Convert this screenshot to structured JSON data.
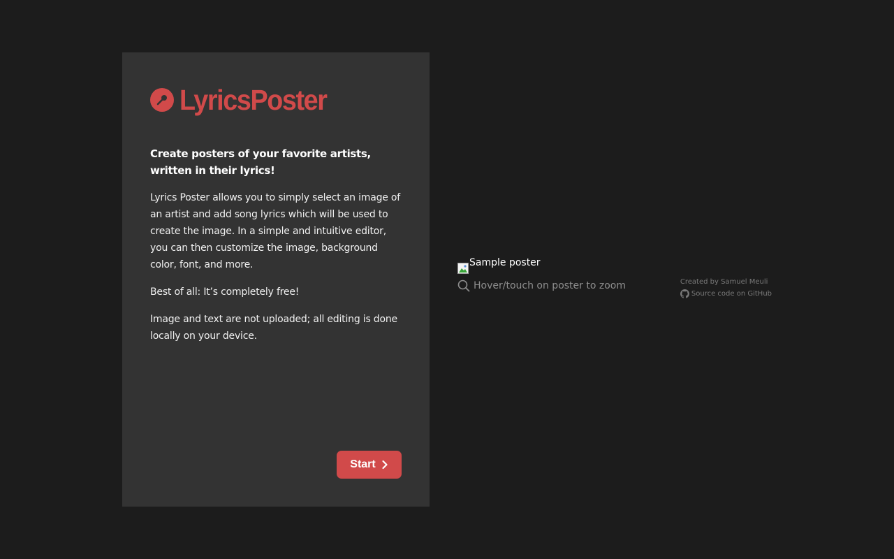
{
  "brand": {
    "name": "LyricsPoster",
    "logo_icon": "microphone-icon",
    "accent_color": "#d14a4a"
  },
  "intro": {
    "tagline": "Create posters of your favorite artists, written in their lyrics!",
    "paragraphs": [
      "Lyrics Poster allows you to simply select an image of an artist and add song lyrics which will be used to create the image. In a simple and intuitive editor, you can then customize the image, background color, font, and more.",
      "Best of all: It’s completely free!",
      "Image and text are not uploaded; all editing is done locally on your device."
    ],
    "start_label": "Start"
  },
  "preview": {
    "image_alt": "Sample poster",
    "zoom_hint": "Hover/touch on poster to zoom"
  },
  "credits": {
    "created_by": "Created by Samuel Meuli",
    "source_link": "Source code on GitHub"
  }
}
